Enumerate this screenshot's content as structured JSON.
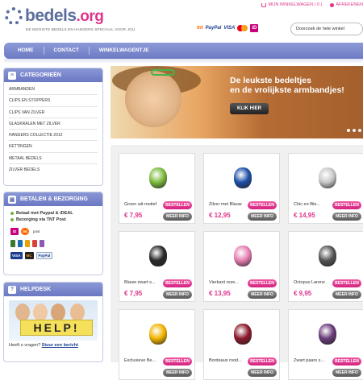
{
  "header": {
    "logo_main": "bedels",
    "logo_tld": ".org",
    "tagline": "DE MOOISTE BEDELS EN HANGERS SPECIAAL VOOR JOU",
    "cart_link": "MIJN WINKELWAGEN ( 0 )",
    "checkout_link": "AFREKENEN",
    "payments": {
      "tnt": "tnt",
      "paypal": "PayPal",
      "visa": "VISA",
      "ideal": "iD"
    },
    "search_placeholder": "Doorzoek de hele winkel"
  },
  "nav": {
    "items": [
      "HOME",
      "CONTACT",
      "WINKELWAGENTJE"
    ]
  },
  "categories": {
    "title": "CATEGORIEËN",
    "items": [
      "ARMBANDEN",
      "CLIPS EN STOPPERS",
      "CLIPS VAN ZILVER",
      "GLASKRALEN MET ZILVER",
      "HANGERS COLLECTIE 2012",
      "KETTINGEN",
      "METAAL BEDELS",
      "ZILVER BEDELS"
    ]
  },
  "payment_box": {
    "title": "BETALEN & BEZORGING",
    "line1": "Betaal met Paypal & iDEAL",
    "line2": "Bezorging via TNT Post",
    "logos_row1": [
      "iD",
      "tnt",
      "post"
    ],
    "logos_row2": [
      "VISA",
      "MC",
      "PayPal"
    ]
  },
  "helpdesk": {
    "title": "HELPDESK",
    "sign": "HELP!",
    "question": "Heeft u vragen?",
    "link": "Stuur een bericht"
  },
  "banner": {
    "line1": "De leukste bedeltjes",
    "line2": "en de vrolijkste armbandjes!",
    "button": "KLIK HIER"
  },
  "products": [
    {
      "name": "Groen wit motief",
      "price": "€ 7,95",
      "color": "#7dbb3c"
    },
    {
      "name": "Zilver met Blauw",
      "price": "€ 12,95",
      "color": "#1f4fa8"
    },
    {
      "name": "Chic en flits...",
      "price": "€ 14,95",
      "color": "#c8c8c8"
    },
    {
      "name": "Blauw zwart s...",
      "price": "€ 7,95",
      "color": "#2a2a2a"
    },
    {
      "name": "Vierkant roze...",
      "price": "€ 13,95",
      "color": "#e67fb3"
    },
    {
      "name": "Octopus Larenz",
      "price": "€ 9,95",
      "color": "#555555"
    },
    {
      "name": "Exclusieve Be...",
      "price": "",
      "color": "#f2b400"
    },
    {
      "name": "Bordeaux rood...",
      "price": "",
      "color": "#8c1a2b"
    },
    {
      "name": "Zwart paars s...",
      "price": "",
      "color": "#6a3b7a"
    }
  ],
  "buttons": {
    "order": "BESTELLEN",
    "more": "MEER INFO"
  }
}
